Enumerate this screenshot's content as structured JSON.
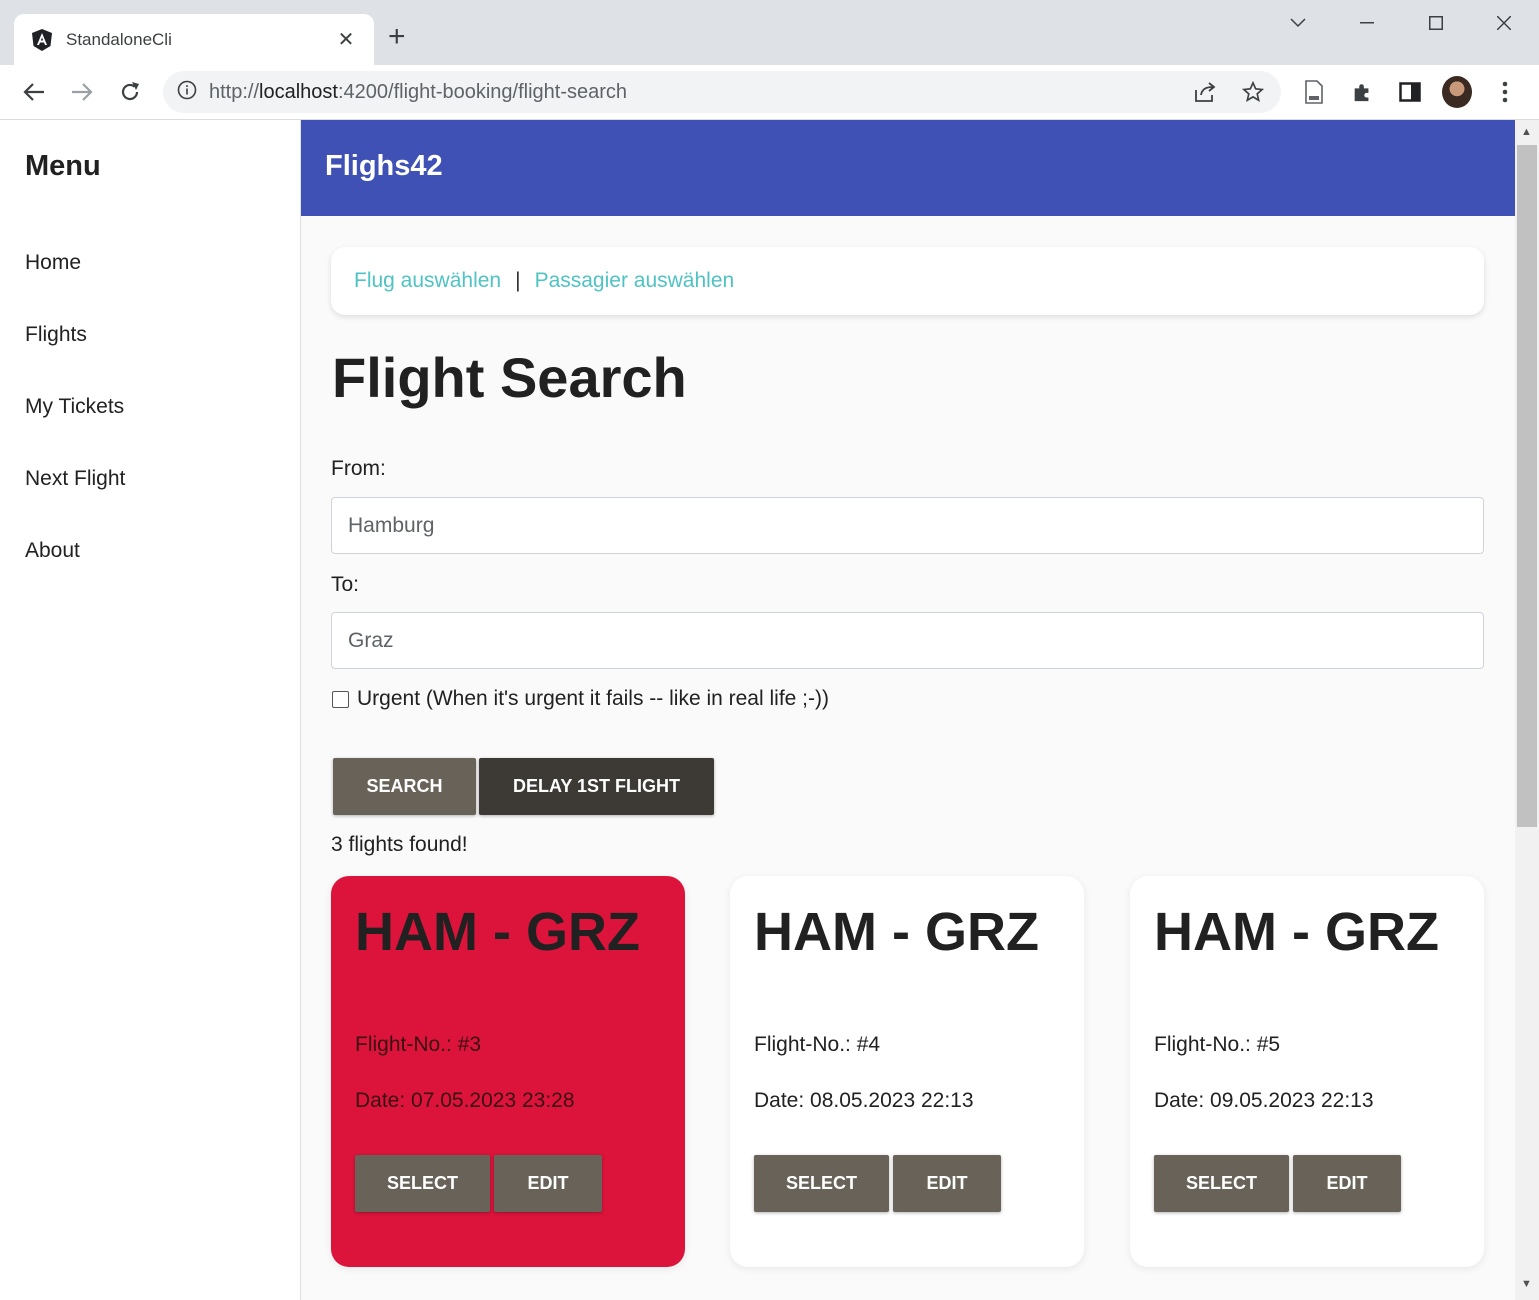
{
  "browser": {
    "tab_title": "StandaloneCli",
    "url_prefix": "http://",
    "url_host": "localhost",
    "url_rest": ":4200/flight-booking/flight-search"
  },
  "sidebar": {
    "title": "Menu",
    "items": [
      {
        "label": "Home"
      },
      {
        "label": "Flights"
      },
      {
        "label": "My Tickets"
      },
      {
        "label": "Next Flight"
      },
      {
        "label": "About"
      }
    ]
  },
  "header": {
    "brand": "Flighs42"
  },
  "breadcrumb": {
    "step1": "Flug auswählen",
    "separator": "|",
    "step2": "Passagier auswählen"
  },
  "page": {
    "title": "Flight Search",
    "from_label": "From:",
    "from_value": "Hamburg",
    "to_label": "To:",
    "to_value": "Graz",
    "urgent_label": "Urgent (When it's urgent it fails -- like in real life ;-))",
    "urgent_checked": false,
    "search_button": "SEARCH",
    "delay_button": "DELAY 1ST FLIGHT",
    "result_count": "3 flights found!"
  },
  "flights": [
    {
      "route": "HAM - GRZ",
      "number": "Flight-No.: #3",
      "date": "Date: 07.05.2023 23:28",
      "selected": true
    },
    {
      "route": "HAM - GRZ",
      "number": "Flight-No.: #4",
      "date": "Date: 08.05.2023 22:13",
      "selected": false
    },
    {
      "route": "HAM - GRZ",
      "number": "Flight-No.: #5",
      "date": "Date: 09.05.2023 22:13",
      "selected": false
    }
  ],
  "card_buttons": {
    "select": "SELECT",
    "edit": "EDIT"
  },
  "colors": {
    "header": "#3f51b5",
    "selected_card": "#dc143c",
    "link": "#4fc3c3",
    "button": "#686259",
    "button_dark": "#3d3935"
  }
}
